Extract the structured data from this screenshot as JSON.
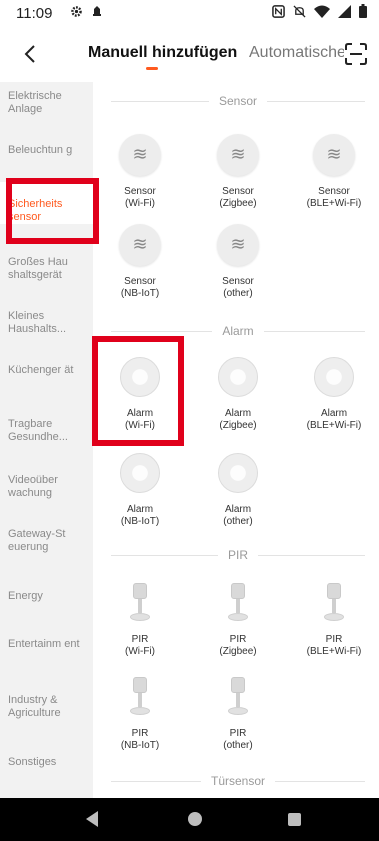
{
  "status_bar": {
    "time": "11:09",
    "left_icons": [
      "gear-icon",
      "notification-icon"
    ],
    "right_icons": [
      "nfc-icon",
      "mute-icon",
      "wifi-icon",
      "signal-icon",
      "battery-icon"
    ]
  },
  "header": {
    "tabs": [
      {
        "label": "Manuell hinzufügen",
        "active": true
      },
      {
        "label": "Automatische",
        "active": false
      }
    ],
    "accent_color": "#ff5a1f"
  },
  "sidebar": {
    "items": [
      {
        "label": "Elektrische Anlage"
      },
      {
        "label": "Beleuchtun g"
      },
      {
        "label": "Sicherheits sensor",
        "active": true
      },
      {
        "label": "Großes Hau shaltsgerät"
      },
      {
        "label": "Kleines Haushalts..."
      },
      {
        "label": "Küchenger ät"
      },
      {
        "label": "Tragbare Gesundhe..."
      },
      {
        "label": "Videoüber wachung"
      },
      {
        "label": "Gateway-St euerung"
      },
      {
        "label": "Energy"
      },
      {
        "label": "Entertainm ent"
      },
      {
        "label": "Industry & Agriculture"
      },
      {
        "label": "Sonstiges"
      }
    ]
  },
  "sections": [
    {
      "title": "Sensor",
      "devices": [
        {
          "name": "Sensor",
          "variant": "(Wi-Fi)"
        },
        {
          "name": "Sensor",
          "variant": "(Zigbee)"
        },
        {
          "name": "Sensor",
          "variant": "(BLE+Wi-Fi)"
        },
        {
          "name": "Sensor",
          "variant": "(NB-IoT)"
        },
        {
          "name": "Sensor",
          "variant": "(other)"
        }
      ]
    },
    {
      "title": "Alarm",
      "devices": [
        {
          "name": "Alarm",
          "variant": "(Wi-Fi)"
        },
        {
          "name": "Alarm",
          "variant": "(Zigbee)"
        },
        {
          "name": "Alarm",
          "variant": "(BLE+Wi-Fi)"
        },
        {
          "name": "Alarm",
          "variant": "(NB-IoT)"
        },
        {
          "name": "Alarm",
          "variant": "(other)"
        }
      ]
    },
    {
      "title": "PIR",
      "devices": [
        {
          "name": "PIR",
          "variant": "(Wi-Fi)"
        },
        {
          "name": "PIR",
          "variant": "(Zigbee)"
        },
        {
          "name": "PIR",
          "variant": "(BLE+Wi-Fi)"
        },
        {
          "name": "PIR",
          "variant": "(NB-IoT)"
        },
        {
          "name": "PIR",
          "variant": "(other)"
        }
      ]
    },
    {
      "title": "Türsensor",
      "devices": []
    }
  ],
  "highlight_color": "#e0001b"
}
